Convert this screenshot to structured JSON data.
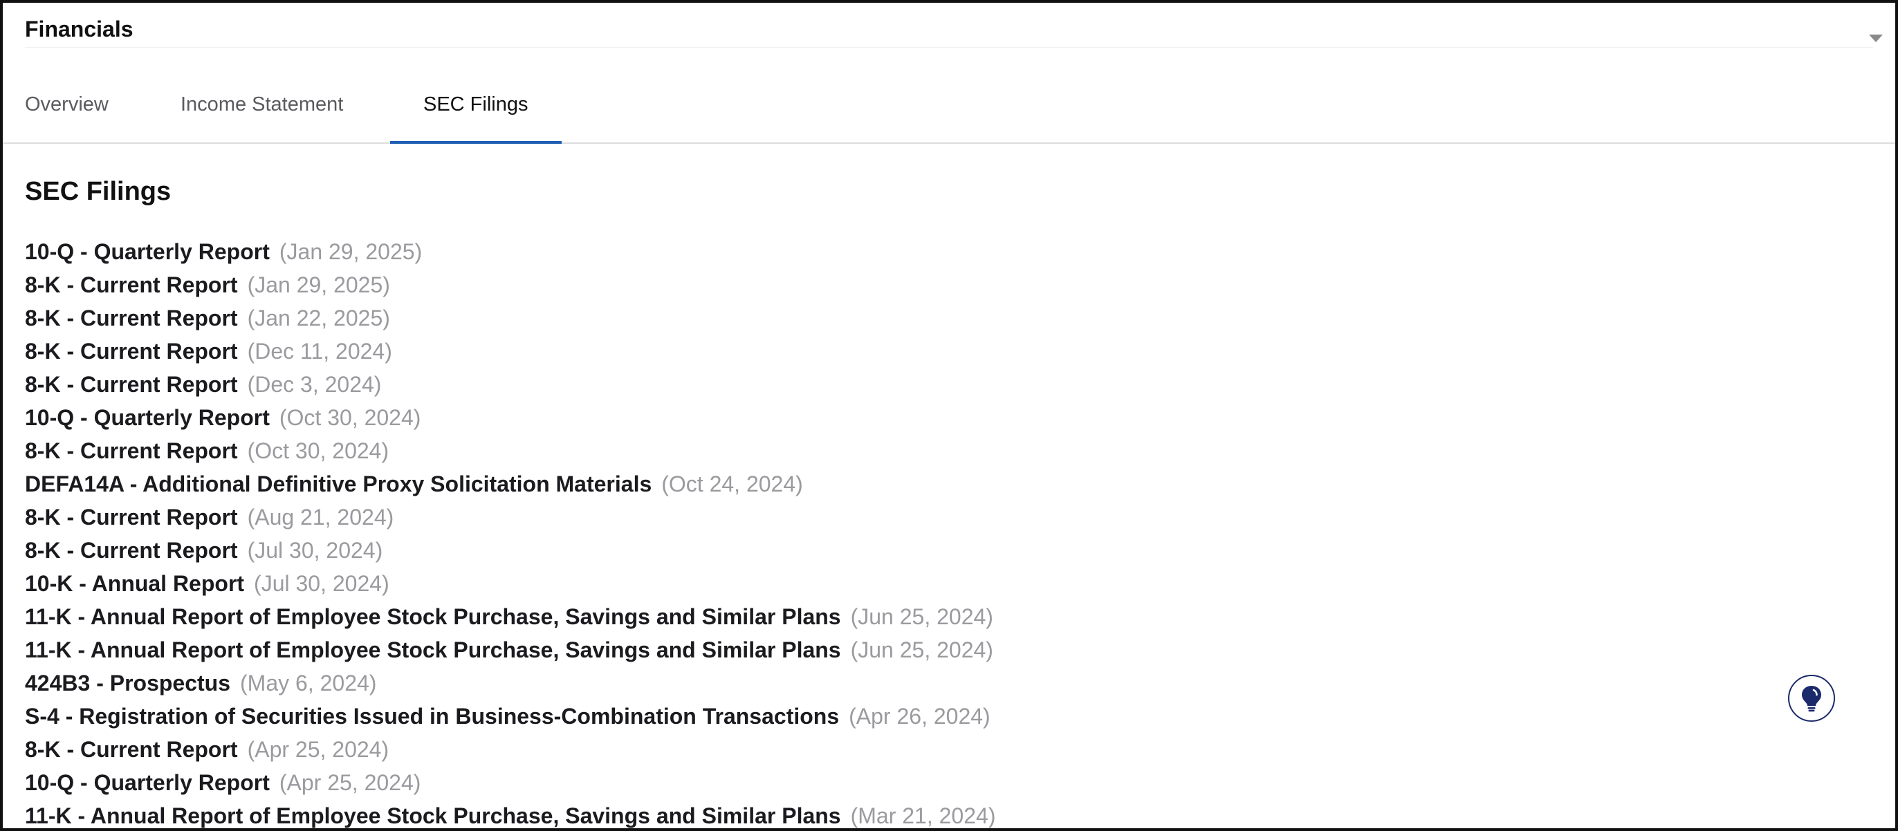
{
  "section": {
    "title": "Financials"
  },
  "tabs": [
    {
      "label": "Overview",
      "active": false
    },
    {
      "label": "Income Statement",
      "active": false
    },
    {
      "label": "SEC Filings",
      "active": true
    }
  ],
  "content": {
    "title": "SEC Filings"
  },
  "filings": [
    {
      "title": "10-Q - Quarterly Report",
      "date": "(Jan 29, 2025)"
    },
    {
      "title": "8-K - Current Report",
      "date": "(Jan 29, 2025)"
    },
    {
      "title": "8-K - Current Report",
      "date": "(Jan 22, 2025)"
    },
    {
      "title": "8-K - Current Report",
      "date": "(Dec 11, 2024)"
    },
    {
      "title": "8-K - Current Report",
      "date": "(Dec 3, 2024)"
    },
    {
      "title": "10-Q - Quarterly Report",
      "date": "(Oct 30, 2024)"
    },
    {
      "title": "8-K - Current Report",
      "date": "(Oct 30, 2024)"
    },
    {
      "title": "DEFA14A - Additional Definitive Proxy Solicitation Materials",
      "date": "(Oct 24, 2024)"
    },
    {
      "title": "8-K - Current Report",
      "date": "(Aug 21, 2024)"
    },
    {
      "title": "8-K - Current Report",
      "date": "(Jul 30, 2024)"
    },
    {
      "title": "10-K - Annual Report",
      "date": "(Jul 30, 2024)"
    },
    {
      "title": "11-K - Annual Report of Employee Stock Purchase, Savings and Similar Plans",
      "date": "(Jun 25, 2024)"
    },
    {
      "title": "11-K - Annual Report of Employee Stock Purchase, Savings and Similar Plans",
      "date": "(Jun 25, 2024)"
    },
    {
      "title": "424B3 - Prospectus",
      "date": "(May 6, 2024)"
    },
    {
      "title": "S-4 - Registration of Securities Issued in Business-Combination Transactions",
      "date": "(Apr 26, 2024)"
    },
    {
      "title": "8-K - Current Report",
      "date": "(Apr 25, 2024)"
    },
    {
      "title": "10-Q - Quarterly Report",
      "date": "(Apr 25, 2024)"
    },
    {
      "title": "11-K - Annual Report of Employee Stock Purchase, Savings and Similar Plans",
      "date": "(Mar 21, 2024)"
    }
  ],
  "icons": {
    "collapse": "chevron-down-icon",
    "help": "lightbulb-icon"
  },
  "colors": {
    "accent": "#1f5fb3",
    "help_icon": "#1b2a6b",
    "date_text": "#9a9a9f"
  }
}
